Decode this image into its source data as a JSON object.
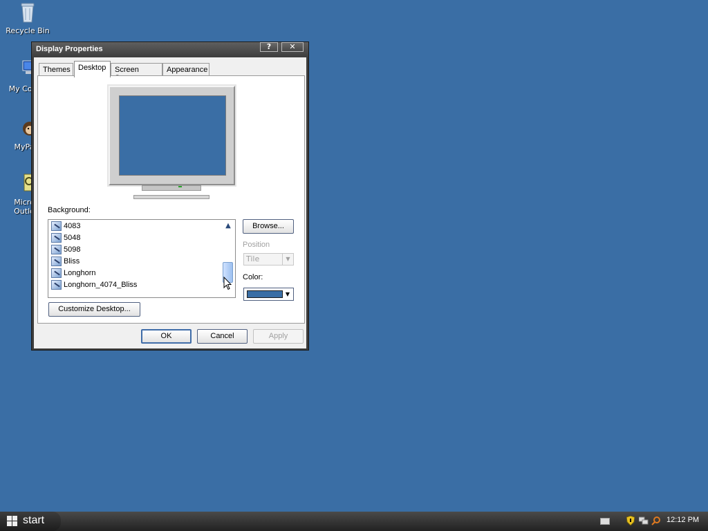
{
  "desktop": {
    "icons": [
      {
        "label": "Recycle Bin",
        "icon": "recycle-bin-icon"
      },
      {
        "label": "My Com",
        "icon": "computer-icon"
      },
      {
        "label": "MyPa",
        "icon": "mypal-icon"
      },
      {
        "label": "Micro",
        "label2": "Outlo",
        "icon": "outlook-icon"
      }
    ]
  },
  "dialog": {
    "title": "Display Properties",
    "help_glyph": "?",
    "close_glyph": "✕",
    "tabs": [
      "Themes",
      "Desktop",
      "Screen Saver",
      "Appearance"
    ],
    "active_tab": "Desktop",
    "background_label": "Background:",
    "background_items": [
      "4083",
      "5048",
      "5098",
      "Bliss",
      "Longhorn",
      "Longhorn_4074_Bliss"
    ],
    "browse_button": "Browse...",
    "position_label": "Position",
    "position_value": "Tile",
    "color_label": "Color:",
    "color_value": "#3a6ea5",
    "customize_button": "Customize Desktop...",
    "ok_button": "OK",
    "cancel_button": "Cancel",
    "apply_button": "Apply"
  },
  "taskbar": {
    "start_label": "start",
    "clock": "12:12 PM"
  },
  "colors": {
    "desktop_bg": "#3a6ea5",
    "taskbar": "#2c2c2c"
  }
}
